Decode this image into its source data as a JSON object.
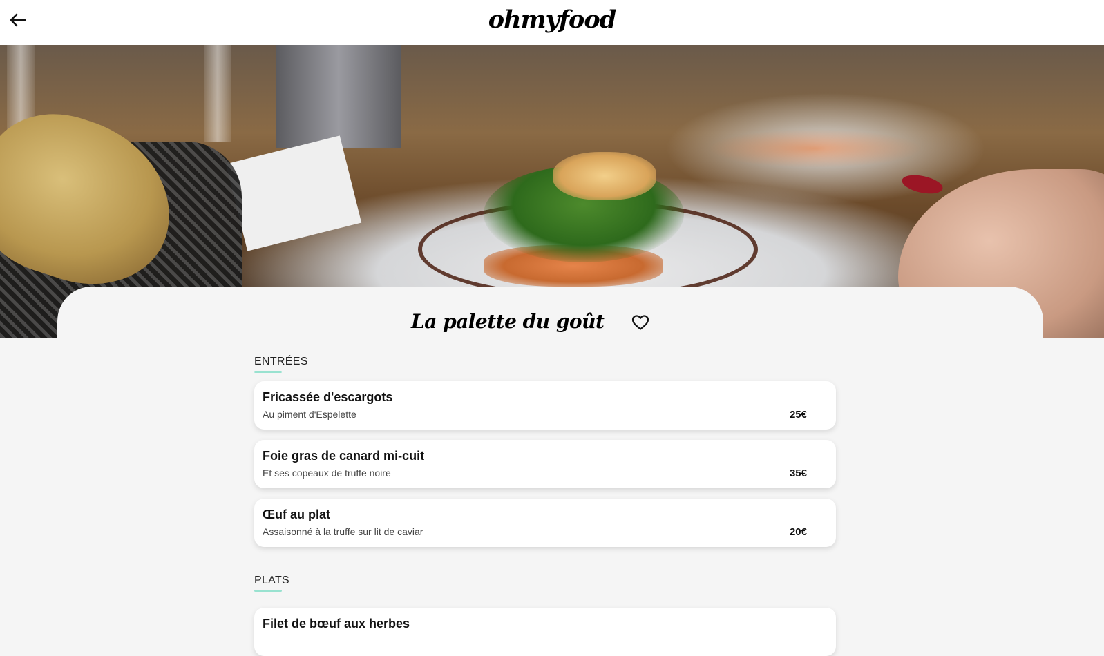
{
  "header": {
    "logo": "ohmyfood",
    "back_icon": "arrow-left-icon"
  },
  "restaurant": {
    "name": "La palette du goût",
    "favorite_icon": "heart-outline-icon"
  },
  "menu": {
    "sections": [
      {
        "title": "ENTRÉES",
        "dishes": [
          {
            "name": "Fricassée d'escargots",
            "description": "Au piment d'Espelette",
            "price": "25€"
          },
          {
            "name": "Foie gras de canard mi-cuit",
            "description": "Et ses copeaux de truffe noire",
            "price": "35€"
          },
          {
            "name": "Œuf au plat",
            "description": "Assaisonné à la truffe sur lit de caviar",
            "price": "20€"
          }
        ]
      },
      {
        "title": "PLATS",
        "dishes": [
          {
            "name": "Filet de bœuf aux herbes"
          }
        ]
      }
    ]
  },
  "colors": {
    "accent_underline": "#99e2d0",
    "background": "#f5f5f5",
    "card": "#ffffff"
  }
}
